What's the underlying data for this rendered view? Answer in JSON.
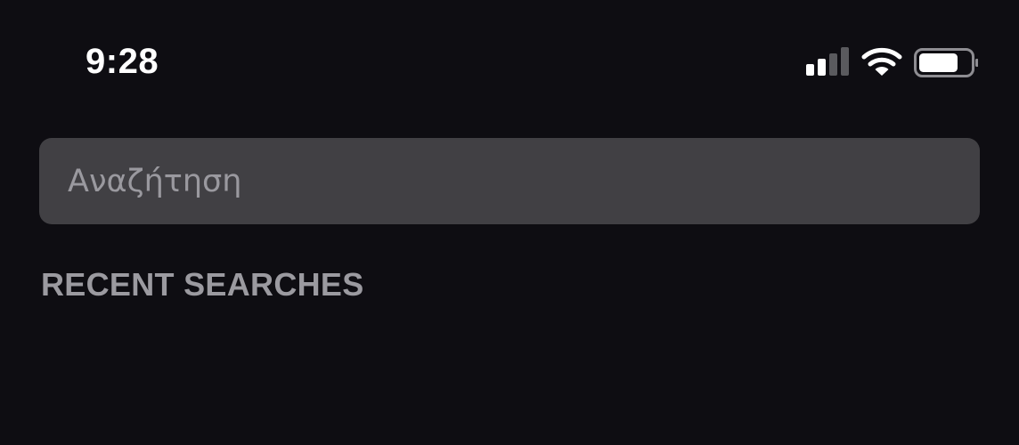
{
  "status_bar": {
    "time": "9:28",
    "icons": [
      "cellular-signal-icon",
      "wifi-icon",
      "battery-icon"
    ],
    "battery_level": 0.75
  },
  "search": {
    "placeholder": "Αναζήτηση",
    "value": ""
  },
  "recent_searches": {
    "title": "RECENT SEARCHES",
    "items": []
  },
  "colors": {
    "background": "#0e0d12",
    "search_field": "#414044",
    "placeholder_text": "#9a999f",
    "section_header": "#9b9aa0",
    "status_foreground": "#ffffff",
    "signal_inactive": "#5a5a5e"
  }
}
